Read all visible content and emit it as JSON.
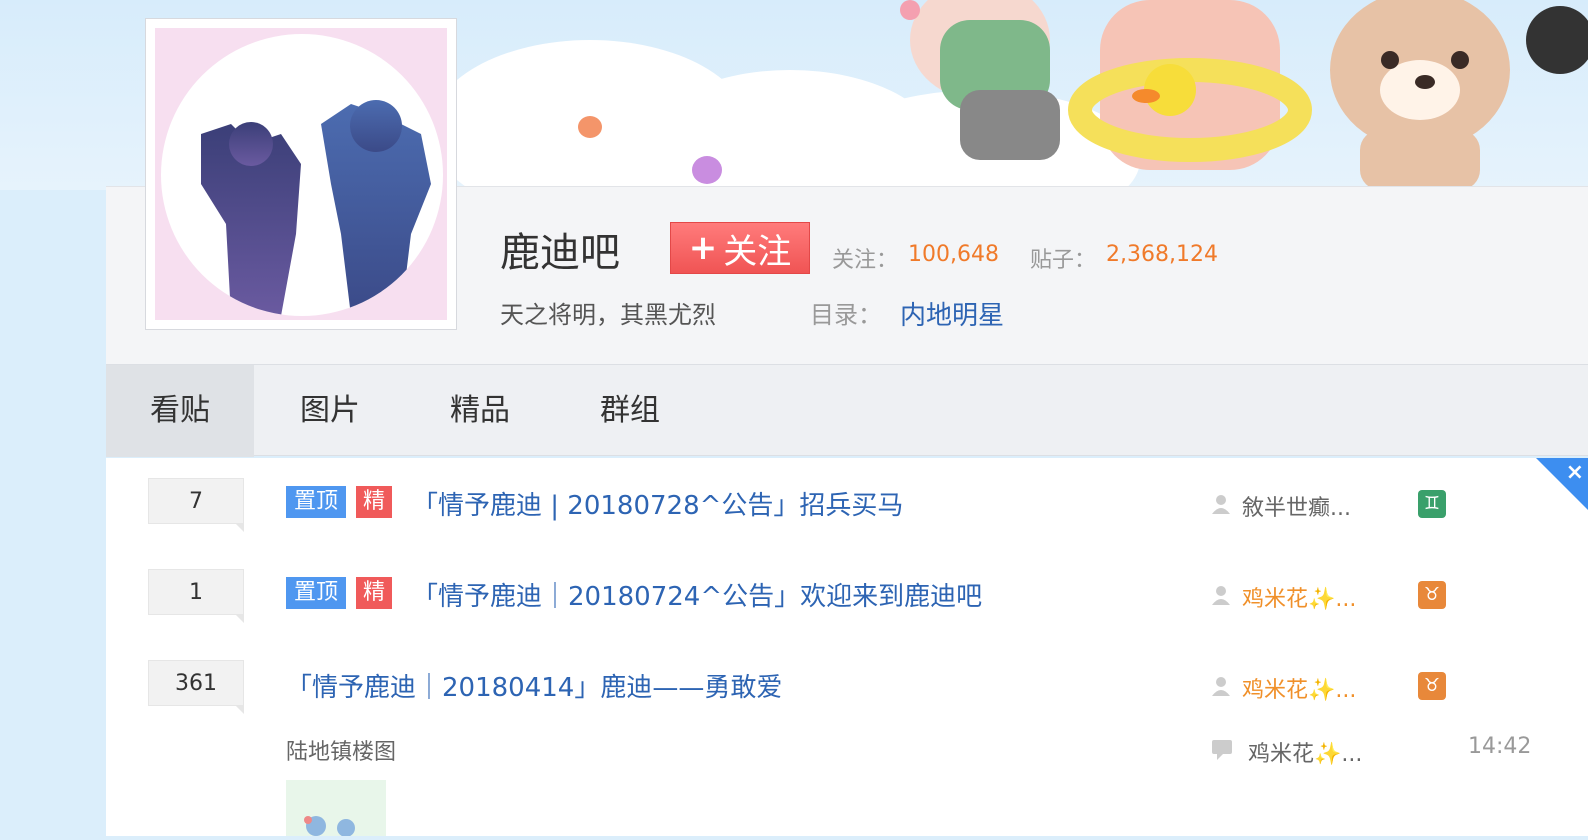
{
  "forum": {
    "name": "鹿迪吧",
    "follow_label": "关注",
    "follow_plus": "+",
    "followers_label": "关注：",
    "followers_count": "100,648",
    "posts_label": "贴子：",
    "posts_count": "2,368,124",
    "slogan": "天之将明，其黑尤烈",
    "directory_label": "目录：",
    "directory_value": "内地明星"
  },
  "tabs": [
    {
      "label": "看贴",
      "active": true
    },
    {
      "label": "图片",
      "active": false
    },
    {
      "label": "精品",
      "active": false
    },
    {
      "label": "群组",
      "active": false
    }
  ],
  "close_glyph": "×",
  "threads": [
    {
      "replies": "7",
      "badges": [
        "置顶",
        "精"
      ],
      "title": "「情予鹿迪 | 20180728^公告」招兵买马",
      "author": "敘半世癫...",
      "author_color": "#666666",
      "zodiac": "♊",
      "zodiac_color": "#3aa06b"
    },
    {
      "replies": "1",
      "badges": [
        "置顶",
        "精"
      ],
      "title": "「情予鹿迪｜20180724^公告」欢迎来到鹿迪吧",
      "author": "鸡米花✨...",
      "author_color": "#f0902a",
      "zodiac": "♉",
      "zodiac_color": "#e8883a"
    },
    {
      "replies": "361",
      "title": "「情予鹿迪｜20180414」鹿迪——勇敢爱",
      "author": "鸡米花✨...",
      "author_color": "#f0902a",
      "zodiac": "♉",
      "zodiac_color": "#e8883a",
      "abstract": "陆地镇楼图",
      "last_reply_user": "鸡米花✨...",
      "last_reply_time": "14:42"
    }
  ],
  "colors": {
    "link": "#2d64b3",
    "stat": "#f07a2a",
    "follow_button": "#f05454",
    "top_badge": "#4f97f0",
    "jing_badge": "#f05a5a",
    "corner": "#3d8ef0"
  }
}
